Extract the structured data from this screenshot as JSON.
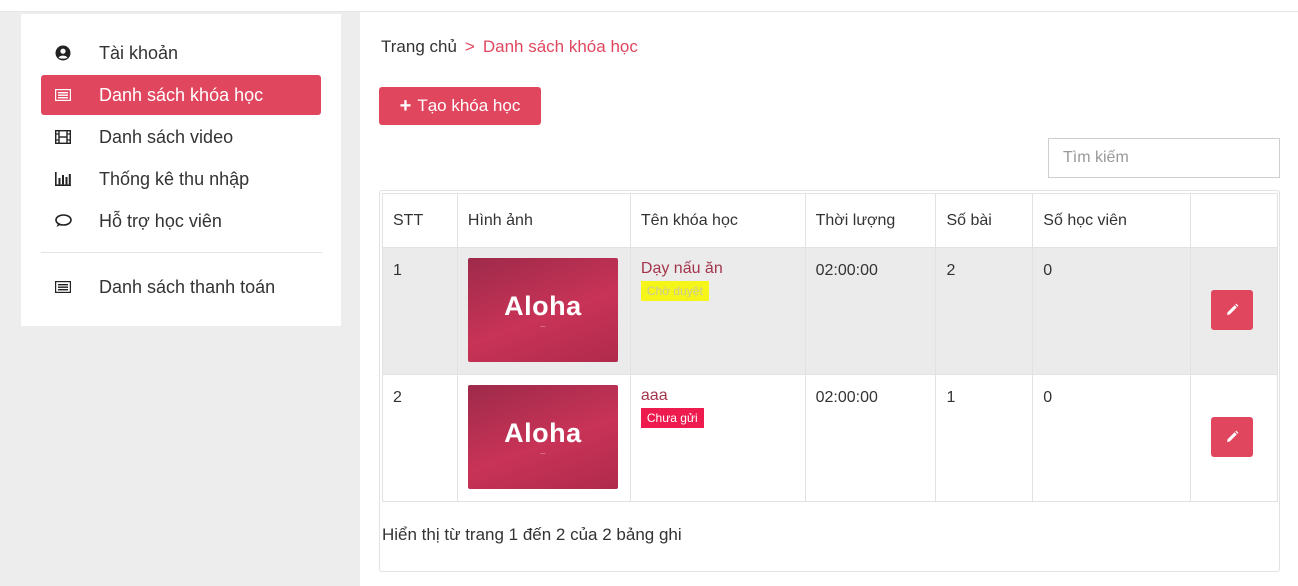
{
  "sidebar": {
    "items": [
      {
        "label": "Tài khoản",
        "icon": "user-circle-icon"
      },
      {
        "label": "Danh sách khóa học",
        "icon": "list-icon",
        "active": true
      },
      {
        "label": "Danh sách video",
        "icon": "film-icon"
      },
      {
        "label": "Thống kê thu nhập",
        "icon": "bar-chart-icon"
      },
      {
        "label": "Hỗ trợ học viên",
        "icon": "chat-icon"
      },
      {
        "label": "Danh sách thanh toán",
        "icon": "list-icon"
      }
    ]
  },
  "breadcrumb": {
    "home": "Trang chủ",
    "separator": ">",
    "current": "Danh sách khóa học"
  },
  "toolbar": {
    "create_label": "Tạo khóa học",
    "search_placeholder": "Tìm kiếm"
  },
  "table": {
    "headers": [
      "STT",
      "Hình ảnh",
      "Tên khóa học",
      "Thời lượng",
      "Số bài",
      "Số học viên",
      ""
    ],
    "rows": [
      {
        "stt": "1",
        "thumb_brand": "Aloha",
        "name": "Dạy nấu ăn",
        "status": "Chờ duyệt",
        "status_color": "#f5f51a",
        "status_text_color": "#c9c9a0",
        "duration": "02:00:00",
        "lessons": "2",
        "students": "0"
      },
      {
        "stt": "2",
        "thumb_brand": "Aloha",
        "name": "aaa",
        "status": "Chưa gửi",
        "status_color": "#ee1b4f",
        "status_text_color": "#ffffff",
        "duration": "02:00:00",
        "lessons": "1",
        "students": "0"
      }
    ]
  },
  "footer": {
    "summary": "Hiển thị từ trang 1 đến 2 của 2 bảng ghi"
  },
  "colors": {
    "accent": "#e0475f",
    "course_name": "#a3354c"
  }
}
